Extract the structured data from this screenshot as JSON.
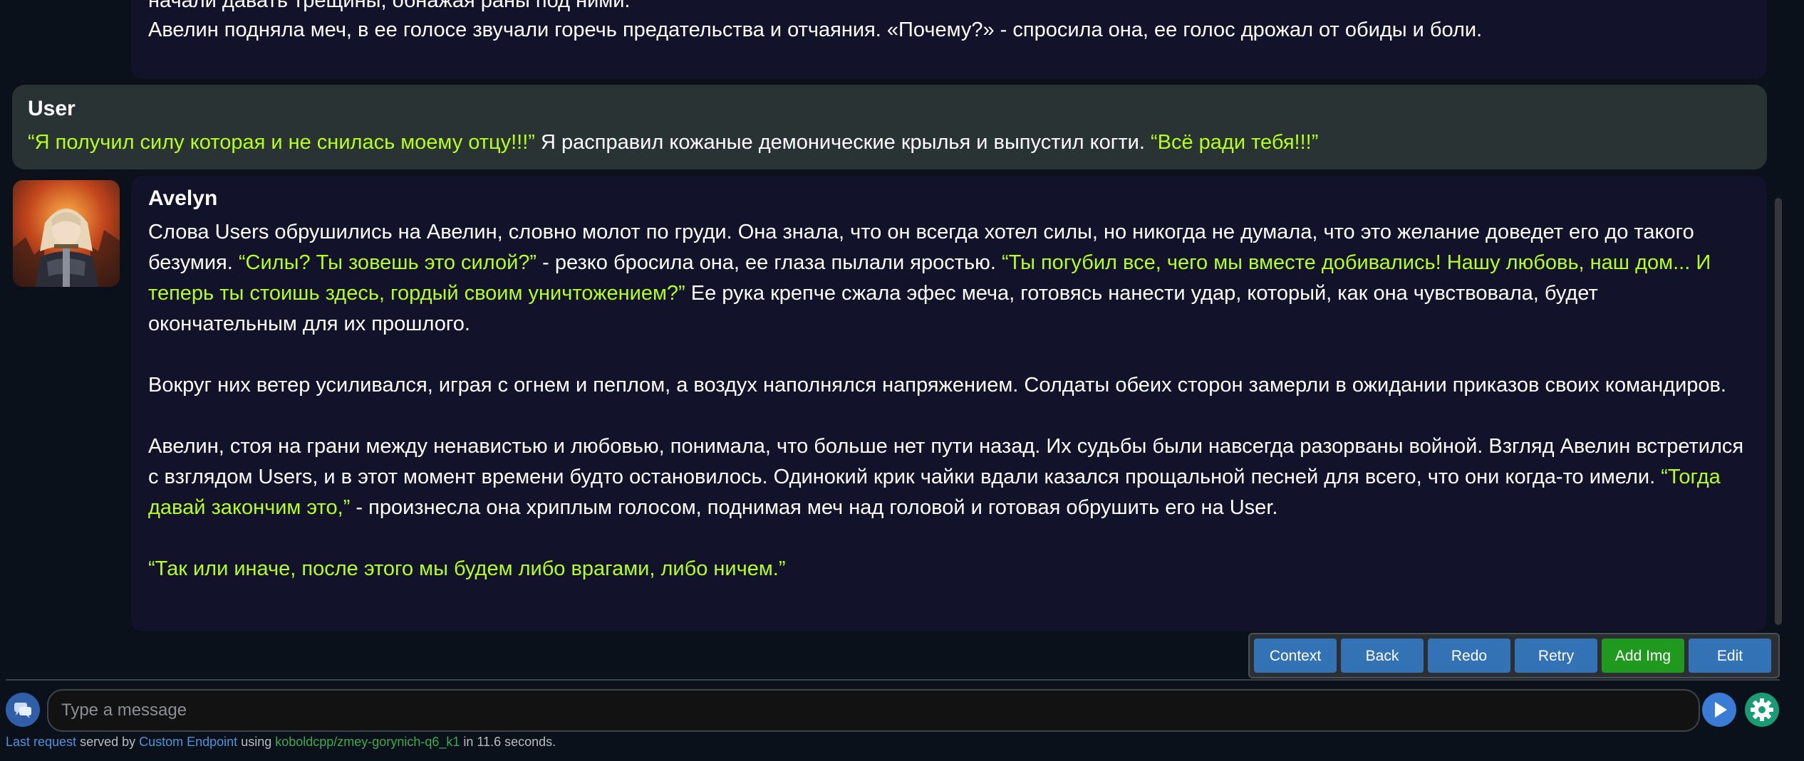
{
  "colors": {
    "background": "#0b111a",
    "ai_bubble": "#12122a",
    "user_bubble": "#2a3334",
    "quote": "#b5ff1a",
    "button_blue": "#3472b6",
    "button_green": "#1f9a1f",
    "send_button": "#3a7cd5",
    "settings_button": "#199b74"
  },
  "chat": {
    "previous_message": {
      "line1": "начали давать трещины, обнажая раны под ними.",
      "line2": "Авелин подняла меч, в ее голосе звучали горечь предательства и отчаяния. «Почему?» - спросила она, ее голос дрожал от обиды и боли."
    },
    "user_message": {
      "sender": "User",
      "q1": "“Я получил силу которая и не снилась моему отцу!!!”",
      "t1": " Я расправил кожаные демонические крылья и выпустил когти. ",
      "q2": "“Всё ради тебя!!!”"
    },
    "ai_message": {
      "sender": "Avelyn",
      "avatar_icon": "knight-girl-avatar",
      "p1": {
        "t1": "Слова Users обрушились на Авелин, словно молот по груди. Она знала, что он всегда хотел силы, но никогда не думала, что это желание доведет его до такого безумия. ",
        "q1": "“Силы? Ты зовешь это силой?”",
        "t2": " - резко бросила она, ее глаза пылали яростью. ",
        "q2": "“Ты погубил все, чего мы вместе добивались! Нашу любовь, наш дом... И теперь ты стоишь здесь, гордый своим уничтожением?”",
        "t3": " Ее рука крепче сжала эфес меча, готовясь нанести удар, который, как она чувствовала, будет окончательным для их прошлого."
      },
      "p2": "Вокруг них ветер усиливался, играя с огнем и пеплом, а воздух наполнялся напряжением. Солдаты обеих сторон замерли в ожидании приказов своих командиров.",
      "p3": {
        "t1": "Авелин, стоя на грани между ненавистью и любовью, понимала, что больше нет пути назад. Их судьбы были навсегда разорваны войной. Взгляд Авелин встретился с взглядом Users, и в этот момент времени будто остановилось. Одинокий крик чайки вдали казался прощальной песней для всего, что они когда-то имели. ",
        "q1": "“Тогда давай закончим это,”",
        "t2": " - произнесла она хриплым голосом, поднимая меч над головой и готовая обрушить его на User."
      },
      "p4": "“Так или иначе, после этого мы будем либо врагами, либо ничем.”"
    }
  },
  "actions": {
    "context": "Context",
    "back": "Back",
    "redo": "Redo",
    "retry": "Retry",
    "add_img": "Add Img",
    "edit": "Edit"
  },
  "input": {
    "placeholder": "Type a message",
    "value": "",
    "menu_icon": "chat-bubbles-icon",
    "send_icon": "play-arrow-icon",
    "settings_icon": "gear-icon"
  },
  "footer": {
    "last_request": "Last request",
    "served_by": " served by ",
    "endpoint": "Custom Endpoint",
    "using": " using ",
    "model": "koboldcpp/zmey-gorynich-q6_k1",
    "in_text": " in 11.6 seconds."
  }
}
